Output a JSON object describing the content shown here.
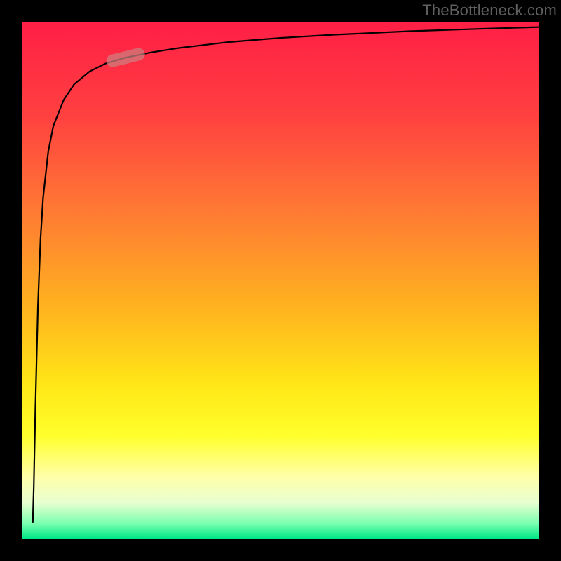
{
  "watermark": {
    "text": "TheBottleneck.com"
  },
  "colors": {
    "frame": "#000000",
    "marker": "#cc807e",
    "gradient_top": "#ff1f46",
    "gradient_bottom": "#00e886"
  },
  "chart_data": {
    "type": "line",
    "title": "",
    "xlabel": "",
    "ylabel": "",
    "xlim": [
      0,
      100
    ],
    "ylim": [
      0,
      100
    ],
    "grid": false,
    "legend": false,
    "series": [
      {
        "name": "curve",
        "x": [
          2,
          2.2,
          2.5,
          3,
          3.5,
          4,
          5,
          6,
          8,
          10,
          13,
          16,
          20,
          25,
          30,
          40,
          50,
          60,
          75,
          90,
          100
        ],
        "y": [
          3,
          10,
          25,
          45,
          58,
          66,
          75,
          80,
          85,
          88,
          90.5,
          92,
          93.2,
          94.2,
          95,
          96.2,
          97,
          97.6,
          98.3,
          98.8,
          99.1
        ]
      }
    ],
    "marker": {
      "x": 20,
      "y": 93.2
    }
  }
}
